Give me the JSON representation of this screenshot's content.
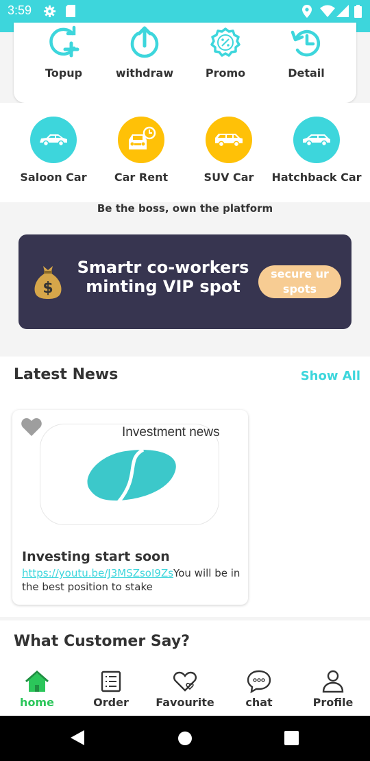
{
  "status_bar": {
    "time": "3:59",
    "icons": [
      "settings-icon",
      "sd-card-icon",
      "location-icon",
      "wifi-icon",
      "signal-icon",
      "battery-icon"
    ]
  },
  "wallet_actions": [
    {
      "label": "Topup",
      "icon": "topup-icon"
    },
    {
      "label": "withdraw",
      "icon": "withdraw-icon"
    },
    {
      "label": "Promo",
      "icon": "promo-icon"
    },
    {
      "label": "Detail",
      "icon": "history-icon"
    }
  ],
  "services": [
    {
      "label": "Saloon Car",
      "icon": "sedan-icon",
      "color": "#3dd6dc"
    },
    {
      "label": "Car Rent",
      "icon": "car-rent-icon",
      "color": "#ffc107"
    },
    {
      "label": "SUV Car",
      "icon": "suv-icon",
      "color": "#ffc107"
    },
    {
      "label": "Hatchback Car",
      "icon": "hatchback-icon",
      "color": "#3dd6dc"
    }
  ],
  "tagline": "Be the boss, own the platform",
  "banner": {
    "title": "Smartr co-workers minting VIP spot",
    "button": "secure ur spots",
    "background": "#373550",
    "button_color": "#f7cc93"
  },
  "news": {
    "section_title": "Latest News",
    "show_all": "Show All",
    "card": {
      "category": "Investment news",
      "title": "Investing start soon",
      "link": "https://youtu.be/J3MSZsoI9Zs",
      "body": "You will be in the best position to stake"
    }
  },
  "customer_section": {
    "title": "What Customer Say?"
  },
  "tabs": [
    {
      "label": "home",
      "icon": "home-icon",
      "active": true
    },
    {
      "label": "Order",
      "icon": "order-list-icon",
      "active": false
    },
    {
      "label": "Favourite",
      "icon": "heart-icon",
      "active": false
    },
    {
      "label": "chat",
      "icon": "chat-icon",
      "active": false
    },
    {
      "label": "Profile",
      "icon": "profile-icon",
      "active": false
    }
  ],
  "colors": {
    "accent": "#3dd6dc",
    "active_tab": "#2bc65a",
    "yellow": "#ffc107"
  }
}
